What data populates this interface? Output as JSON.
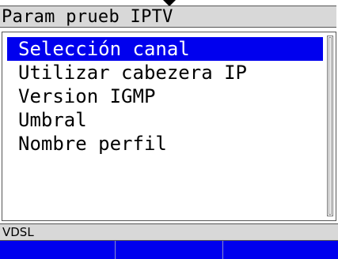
{
  "window": {
    "title": "Param prueb IPTV"
  },
  "menu": {
    "items": [
      {
        "label": "Selección canal",
        "selected": true
      },
      {
        "label": "Utilizar cabezera IP",
        "selected": false
      },
      {
        "label": "Version IGMP",
        "selected": false
      },
      {
        "label": "Umbral",
        "selected": false
      },
      {
        "label": "Nombre perfil",
        "selected": false
      }
    ]
  },
  "status": {
    "text": "VDSL"
  },
  "softkeys": [
    {
      "label": ""
    },
    {
      "label": ""
    },
    {
      "label": ""
    }
  ],
  "colors": {
    "selection": "#0000ee",
    "softkey": "#0000ee",
    "bar": "#d8d8d8"
  },
  "icons": {
    "top_indicator": "down-arrow-icon"
  }
}
